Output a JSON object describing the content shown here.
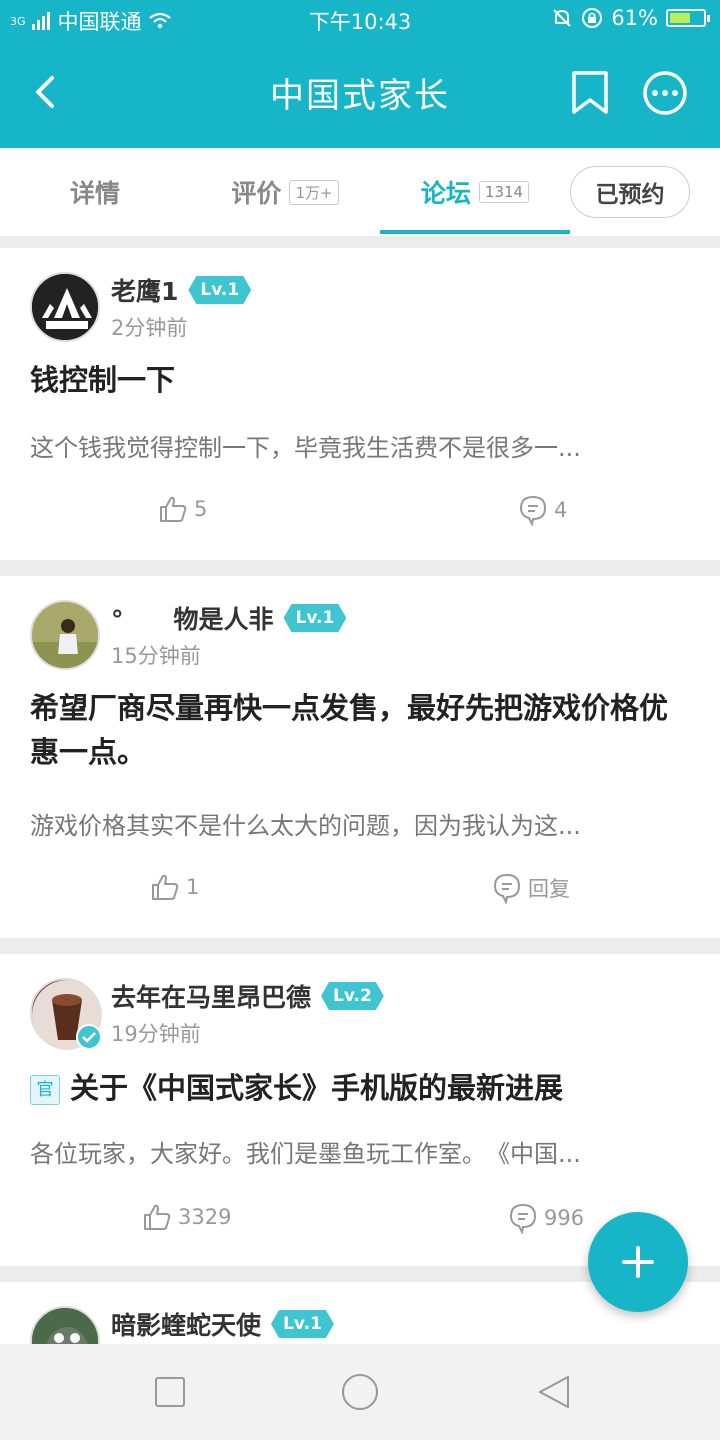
{
  "status_bar": {
    "network": "3G",
    "carrier": "中国联通",
    "time": "下午10:43",
    "battery": "61%",
    "battery_level": 0.61
  },
  "header": {
    "title": "中国式家长",
    "back_icon": "chevron-left-icon",
    "bookmark_icon": "bookmark-icon",
    "more_icon": "more-circle-icon"
  },
  "tabs": [
    {
      "label": "详情",
      "count": ""
    },
    {
      "label": "评价",
      "count": "1万+"
    },
    {
      "label": "论坛",
      "count": "1314"
    }
  ],
  "reserved_button": "已预约",
  "posts": [
    {
      "username": "老鹰1",
      "level": "Lv.1",
      "time": "2分钟前",
      "title": "钱控制一下",
      "official": false,
      "excerpt": "这个钱我觉得控制一下，毕竟我生活费不是很多一...",
      "likes": "5",
      "comments": "4"
    },
    {
      "username": "°　　物是人非",
      "level": "Lv.1",
      "time": "15分钟前",
      "title": "希望厂商尽量再快一点发售，最好先把游戏价格优惠一点。",
      "official": false,
      "excerpt": "游戏价格其实不是什么太大的问题，因为我认为这...",
      "likes": "1",
      "comments": "回复"
    },
    {
      "username": "去年在马里昂巴德",
      "level": "Lv.2",
      "time": "19分钟前",
      "official_tag": "官",
      "title": "关于《中国式家长》手机版的最新进展",
      "official": true,
      "excerpt": "各位玩家，大家好。我们是墨鱼玩工作室。　《中国...",
      "likes": "3329",
      "comments": "996"
    },
    {
      "username": "暗影蝰蛇天使",
      "level": "Lv.1"
    }
  ],
  "colors": {
    "primary": "#16b6c8",
    "level_badge": "#3ec5d0"
  }
}
